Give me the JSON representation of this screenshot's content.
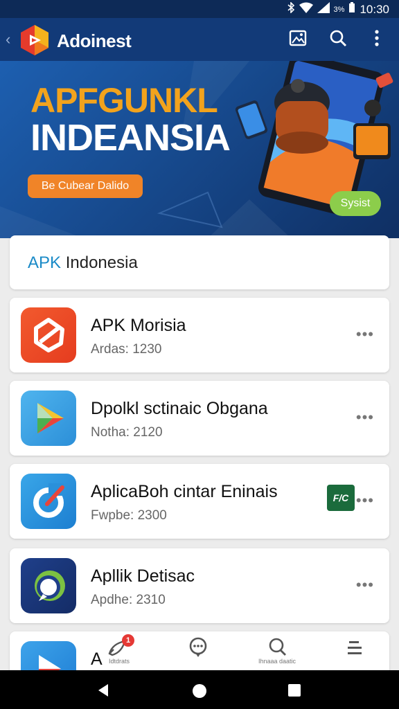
{
  "status_bar": {
    "time": "10:30",
    "battery": "3%"
  },
  "header": {
    "back_icon": "chevron-left-icon",
    "app_title": "Adoinest",
    "actions": [
      "image-icon",
      "search-icon",
      "more-vertical-icon"
    ]
  },
  "banner": {
    "title_line1": "APFGUNKL",
    "title_line2": "INDEANSIA",
    "cta_label": "Be Cubear Dalido",
    "pill_label": "Sysist"
  },
  "section": {
    "title_accent": "APK",
    "title_rest": " Indonesia"
  },
  "apps": [
    {
      "name": "APK Morisia",
      "meta": "Ardas: 1230",
      "icon": "red-refresh-app-icon"
    },
    {
      "name": "Dpolkl sctinaic Obgana",
      "meta": "Notha: 2120",
      "icon": "play-store-app-icon"
    },
    {
      "name": "AplicaBoh cintar Eninais",
      "meta": "Fwpbe: 2300",
      "icon": "blue-download-app-icon",
      "badge": "F/C"
    },
    {
      "name": "Apllik Detisac",
      "meta": "Apdhe: 2310",
      "icon": "chat-app-icon"
    },
    {
      "name": "A",
      "icon": "blue-play-app-icon"
    }
  ],
  "bottom_nav": [
    {
      "label": "Idtdrats",
      "icon": "rocket-icon",
      "badge": "1"
    },
    {
      "label": "",
      "icon": "chat-bubble-icon"
    },
    {
      "label": "Ihnaaa daatic",
      "icon": "search-icon"
    },
    {
      "label": "",
      "icon": "menu-icon"
    }
  ],
  "colors": {
    "header": "#123a78",
    "accent_orange": "#f08428",
    "accent_green": "#8ccd4b",
    "title_orange": "#f2a31d",
    "link_blue": "#1a8ac7"
  }
}
